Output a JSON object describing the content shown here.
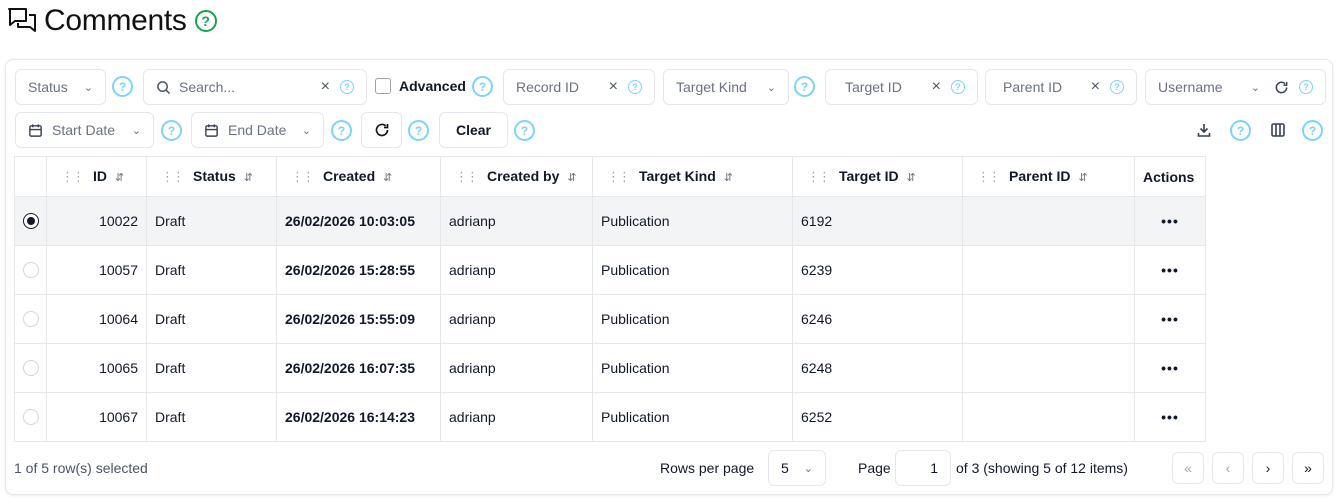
{
  "header": {
    "title": "Comments",
    "icon": "chat-bubbles-icon"
  },
  "filters": {
    "status_placeholder": "Status",
    "search_placeholder": "Search...",
    "advanced_label": "Advanced",
    "record_id_placeholder": "Record ID",
    "target_kind_placeholder": "Target Kind",
    "target_id_placeholder": "Target ID",
    "parent_id_placeholder": "Parent ID",
    "username_placeholder": "Username",
    "start_date_placeholder": "Start Date",
    "end_date_placeholder": "End Date",
    "clear_label": "Clear"
  },
  "table": {
    "columns": [
      "ID",
      "Status",
      "Created",
      "Created by",
      "Target Kind",
      "Target ID",
      "Parent ID",
      "Actions"
    ],
    "rows": [
      {
        "selected": true,
        "id": "10022",
        "status": "Draft",
        "created": "26/02/2026 10:03:05",
        "created_by": "adrianp",
        "target_kind": "Publication",
        "target_id": "6192",
        "parent_id": ""
      },
      {
        "selected": false,
        "id": "10057",
        "status": "Draft",
        "created": "26/02/2026 15:28:55",
        "created_by": "adrianp",
        "target_kind": "Publication",
        "target_id": "6239",
        "parent_id": ""
      },
      {
        "selected": false,
        "id": "10064",
        "status": "Draft",
        "created": "26/02/2026 15:55:09",
        "created_by": "adrianp",
        "target_kind": "Publication",
        "target_id": "6246",
        "parent_id": ""
      },
      {
        "selected": false,
        "id": "10065",
        "status": "Draft",
        "created": "26/02/2026 16:07:35",
        "created_by": "adrianp",
        "target_kind": "Publication",
        "target_id": "6248",
        "parent_id": ""
      },
      {
        "selected": false,
        "id": "10067",
        "status": "Draft",
        "created": "26/02/2026 16:14:23",
        "created_by": "adrianp",
        "target_kind": "Publication",
        "target_id": "6252",
        "parent_id": ""
      }
    ]
  },
  "footer": {
    "selection_text": "1 of 5 row(s) selected",
    "rows_per_page_label": "Rows per page",
    "rows_per_page_value": "5",
    "page_label": "Page",
    "page_value": "1",
    "page_info": "of 3 (showing 5 of 12 items)"
  },
  "colors": {
    "help_icon": "#7dd3fc",
    "title_help": "#16a34a",
    "border": "#e5e7eb"
  }
}
